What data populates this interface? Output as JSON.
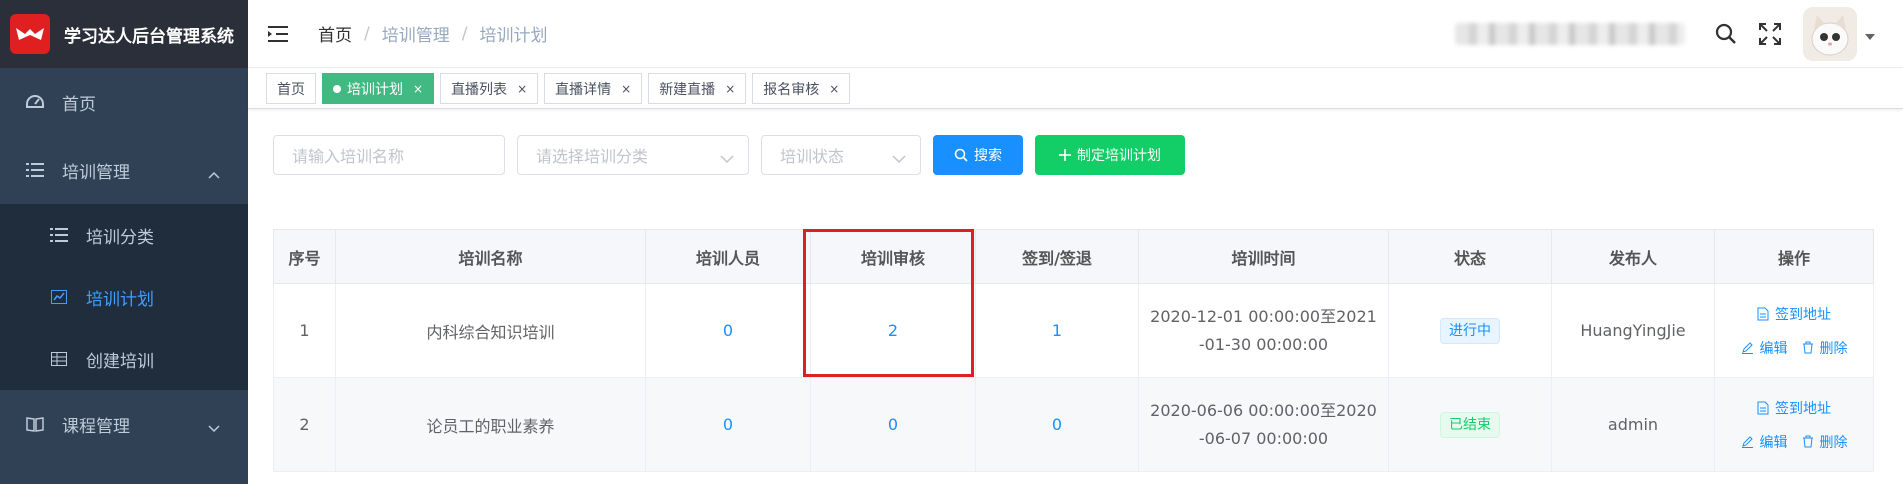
{
  "app": {
    "title": "学习达人后台管理系统"
  },
  "sidebar": {
    "items": [
      {
        "label": "首页",
        "icon": "dashboard-icon"
      },
      {
        "label": "培训管理",
        "icon": "list-icon",
        "expanded": true,
        "children": [
          {
            "label": "培训分类",
            "icon": "list-icon"
          },
          {
            "label": "培训计划",
            "icon": "chart-icon",
            "active": true
          },
          {
            "label": "创建培训",
            "icon": "table-icon"
          }
        ]
      },
      {
        "label": "课程管理",
        "icon": "book-icon",
        "expanded": false
      }
    ]
  },
  "breadcrumb": [
    "首页",
    "培训管理",
    "培训计划"
  ],
  "tags": [
    {
      "label": "首页"
    },
    {
      "label": "培训计划",
      "active": true
    },
    {
      "label": "直播列表"
    },
    {
      "label": "直播详情"
    },
    {
      "label": "新建直播"
    },
    {
      "label": "报名审核"
    }
  ],
  "filters": {
    "name_placeholder": "请输入培训名称",
    "category_placeholder": "请选择培训分类",
    "status_placeholder": "培训状态",
    "search_label": "搜索",
    "create_label": "制定培训计划"
  },
  "table": {
    "columns": [
      "序号",
      "培训名称",
      "培训人员",
      "培训审核",
      "签到/签退",
      "培训时间",
      "状态",
      "发布人",
      "操作"
    ],
    "rows": [
      {
        "index": "1",
        "name": "内科综合知识培训",
        "staff": "0",
        "review": "2",
        "checkin": "1",
        "time_line1": "2020-12-01 00:00:00至2021",
        "time_line2": "-01-30 00:00:00",
        "status": "进行中",
        "publisher": "HuangYingJie"
      },
      {
        "index": "2",
        "name": "论员工的职业素养",
        "staff": "0",
        "review": "0",
        "checkin": "0",
        "time_line1": "2020-06-06 00:00:00至2020",
        "time_line2": "-06-07 00:00:00",
        "status": "已结束",
        "publisher": "admin"
      }
    ],
    "ops": {
      "signin": "签到地址",
      "edit": "编辑",
      "delete": "删除"
    }
  },
  "colors": {
    "sidebar": "#304156",
    "primary": "#1890ff",
    "success": "#13ce66",
    "tag_active": "#42b983",
    "highlight": "#e02020"
  }
}
